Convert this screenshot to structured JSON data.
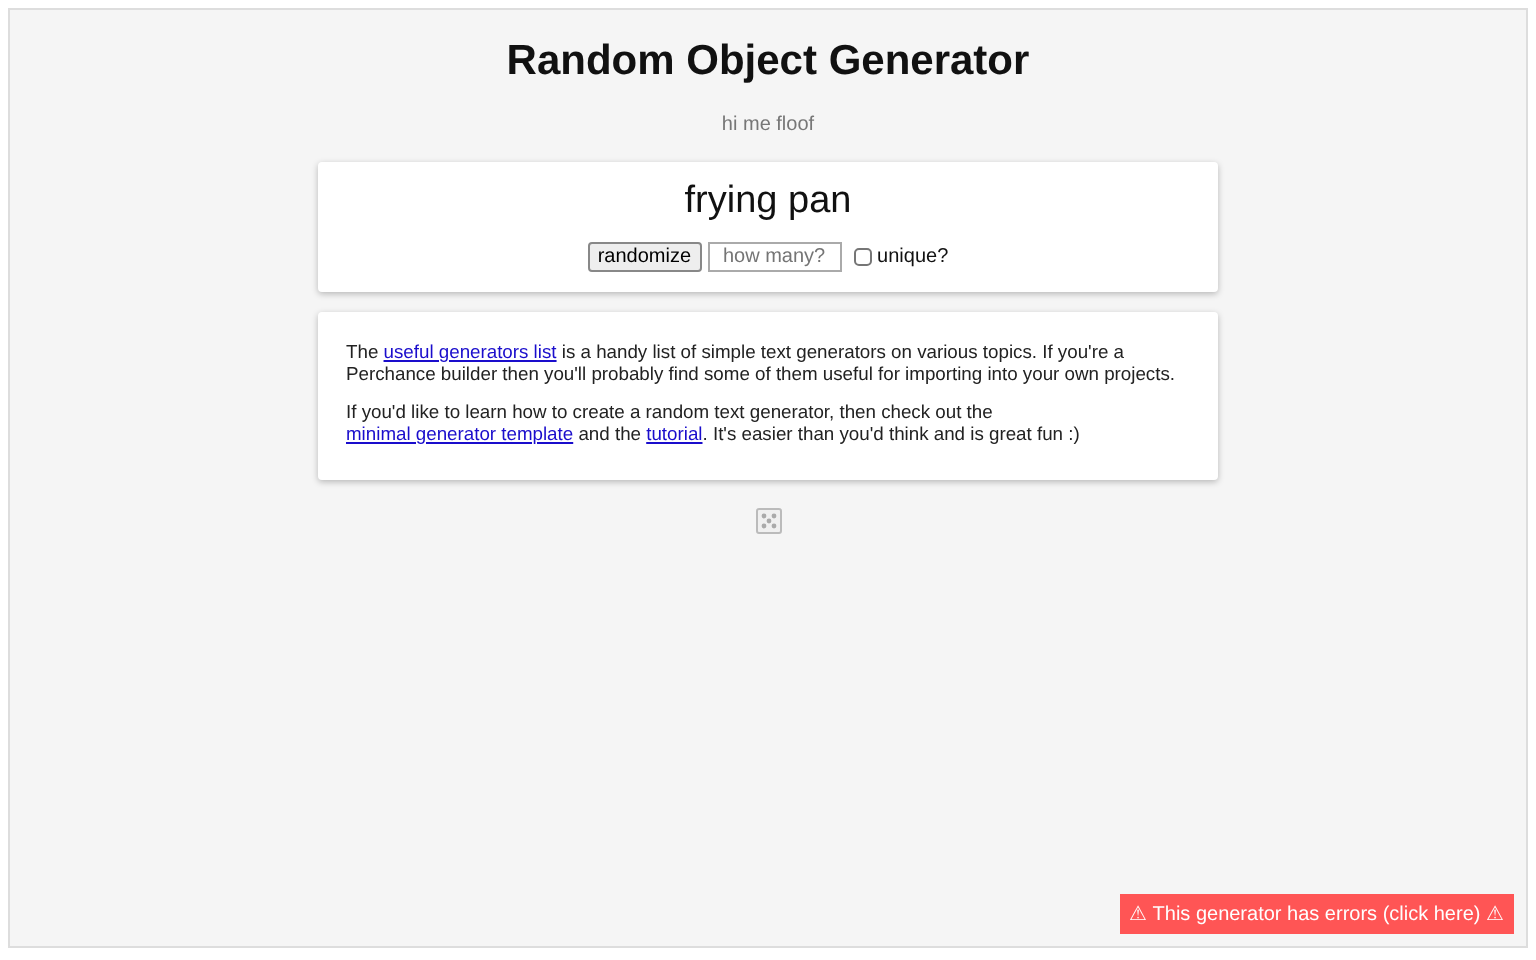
{
  "title": "Random Object Generator",
  "subtitle": "hi me floof",
  "output": "frying pan",
  "controls": {
    "button": "randomize",
    "count_placeholder": "how many?",
    "unique_label": "unique?",
    "unique_checked": false
  },
  "info": [
    [
      {
        "kind": "text",
        "text": "The "
      },
      {
        "kind": "link",
        "text": "useful generators list"
      },
      {
        "kind": "text",
        "text": " is a handy list of simple text generators on various topics. If you're a Perchance builder then you'll probably find some of them useful for importing into your own projects."
      }
    ],
    [
      {
        "kind": "text",
        "text": "If you'd like to learn how to create a random text generator, then check out the "
      },
      {
        "kind": "link",
        "text": "minimal generator template"
      },
      {
        "kind": "text",
        "text": " and the "
      },
      {
        "kind": "link",
        "text": "tutorial"
      },
      {
        "kind": "text",
        "text": ". It's easier than you'd think and is great fun :)"
      }
    ]
  ],
  "error_notice": "⚠ This generator has errors (click here) ⚠"
}
